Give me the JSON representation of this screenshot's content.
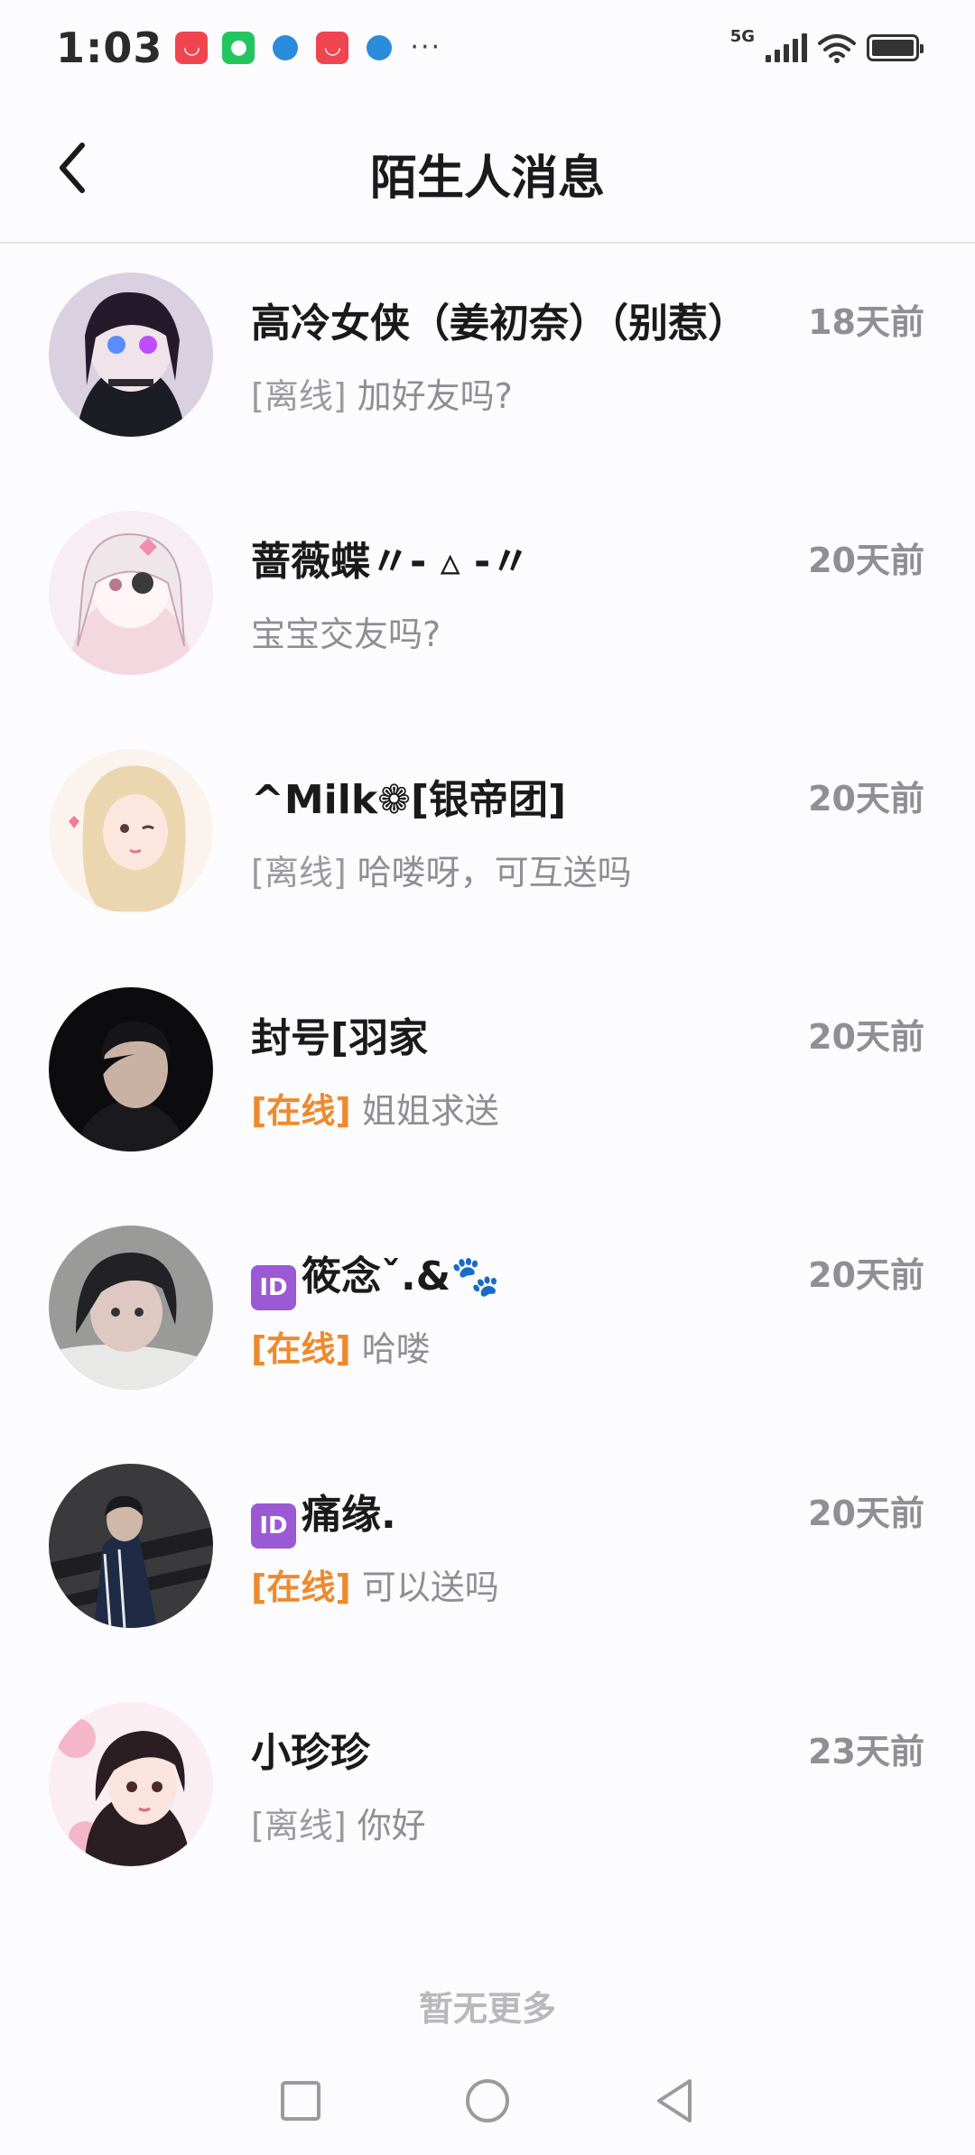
{
  "status_bar": {
    "time": "1:03",
    "more": "···",
    "network": "5G"
  },
  "header": {
    "title": "陌生人消息"
  },
  "conversations": [
    {
      "name": "高冷女侠（姜初奈）（别惹）",
      "time": "18天前",
      "status": "[离线]",
      "status_type": "offline",
      "message": "加好友吗?",
      "id_badge": ""
    },
    {
      "name": "蔷薇蝶〃- ▵ -〃",
      "time": "20天前",
      "status": "",
      "status_type": "none",
      "message": "宝宝交友吗?",
      "id_badge": ""
    },
    {
      "name": "^Milk❁[银帝团]",
      "time": "20天前",
      "status": "[离线]",
      "status_type": "offline",
      "message": "哈喽呀，可互送吗",
      "id_badge": ""
    },
    {
      "name": "封号[羽家",
      "time": "20天前",
      "status": "[在线]",
      "status_type": "online",
      "message": "姐姐求送",
      "id_badge": ""
    },
    {
      "name": "筱念ˇ.&🐾",
      "time": "20天前",
      "status": "[在线]",
      "status_type": "online",
      "message": "哈喽",
      "id_badge": "ID"
    },
    {
      "name": "痛缘.",
      "time": "20天前",
      "status": "[在线]",
      "status_type": "online",
      "message": "可以送吗",
      "id_badge": "ID"
    },
    {
      "name": "小珍珍",
      "time": "23天前",
      "status": "[离线]",
      "status_type": "offline",
      "message": "你好",
      "id_badge": ""
    }
  ],
  "footer": {
    "no_more": "暂无更多"
  },
  "colors": {
    "online": "#ee8a2c",
    "offline": "#9a9aa0",
    "id_badge": "#9b59d6"
  }
}
